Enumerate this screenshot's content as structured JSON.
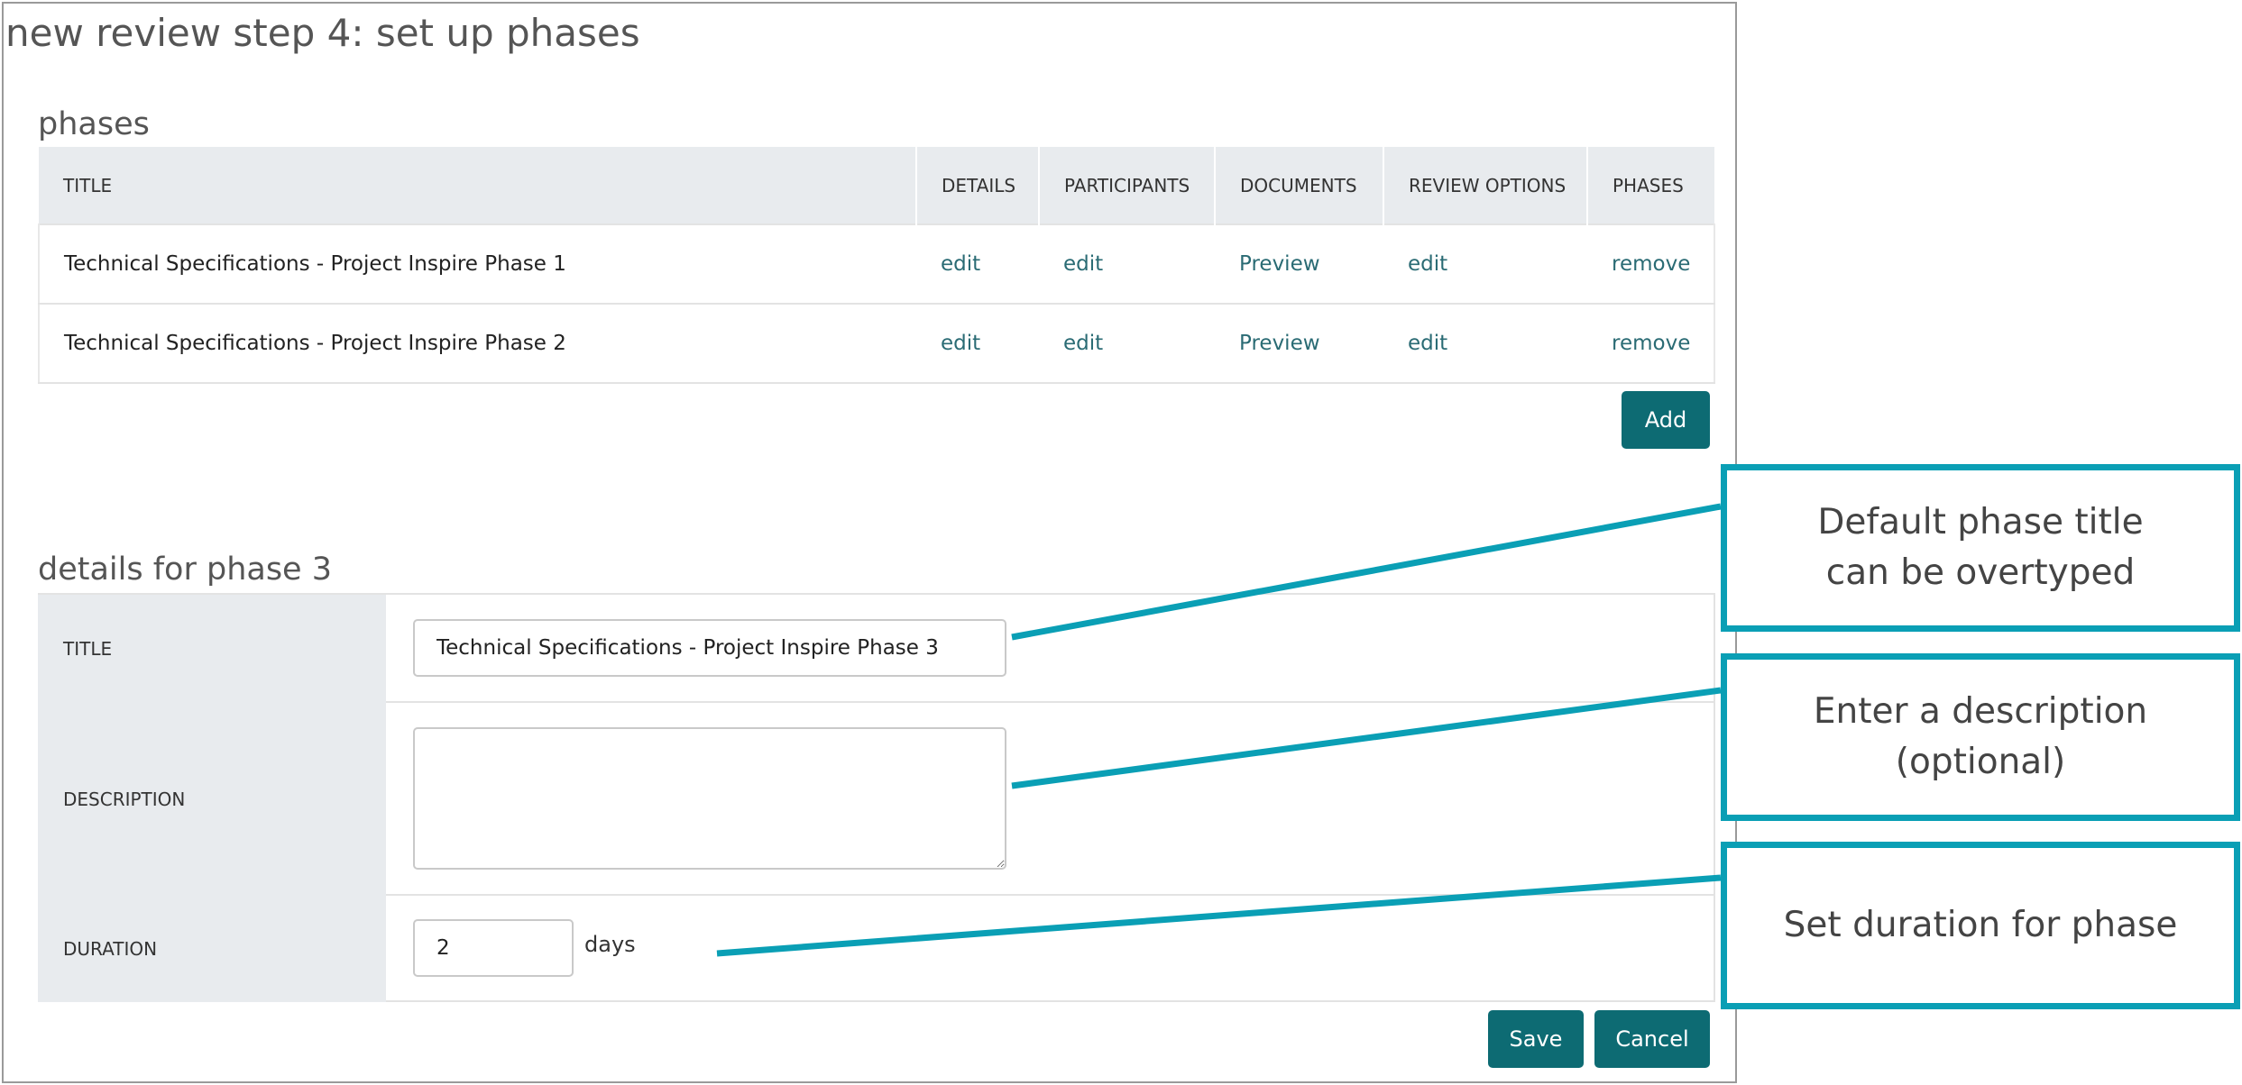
{
  "page_title": "new review step 4: set up phases",
  "phases_section": {
    "title": "phases",
    "columns": [
      "TITLE",
      "DETAILS",
      "PARTICIPANTS",
      "DOCUMENTS",
      "REVIEW OPTIONS",
      "PHASES"
    ],
    "rows": [
      {
        "title": "Technical Specifications - Project Inspire Phase 1",
        "details": "edit",
        "participants": "edit",
        "documents": "Preview",
        "review_options": "edit",
        "phases": "remove"
      },
      {
        "title": "Technical Specifications - Project Inspire Phase 2",
        "details": "edit",
        "participants": "edit",
        "documents": "Preview",
        "review_options": "edit",
        "phases": "remove"
      }
    ],
    "add_label": "Add"
  },
  "details_section": {
    "title": "details for phase 3",
    "title_label": "TITLE",
    "title_value": "Technical Specifications - Project Inspire Phase 3",
    "description_label": "DESCRIPTION",
    "description_value": "",
    "duration_label": "DURATION",
    "duration_value": "2",
    "duration_unit": "days"
  },
  "actions": {
    "save_label": "Save",
    "cancel_label": "Cancel"
  },
  "callouts": [
    {
      "text": "Default phase title\ncan be overtyped"
    },
    {
      "text": "Enter a description\n(optional)"
    },
    {
      "text": "Set duration for phase"
    }
  ],
  "colors": {
    "accent": "#0d6b73",
    "callout_border": "#0a9fb5",
    "link": "#2a6b74",
    "header_bg": "#e8ebee"
  }
}
